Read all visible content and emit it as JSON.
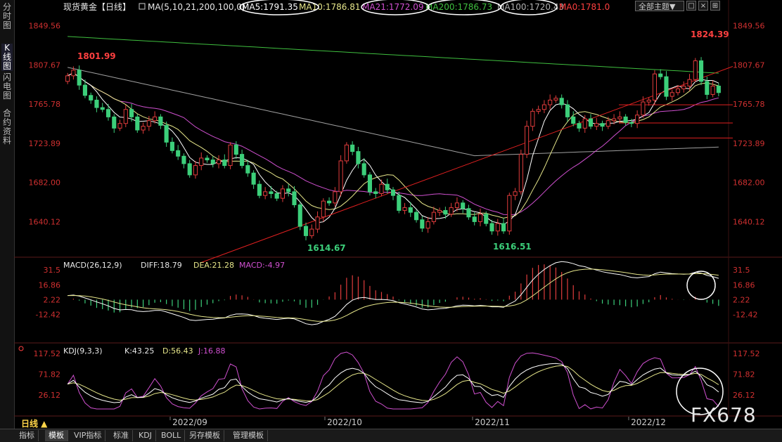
{
  "left_tabs": [
    {
      "label": "分时图",
      "active": false
    },
    {
      "label": "K线图",
      "active": true
    },
    {
      "label": "闪电图",
      "active": false
    },
    {
      "label": "合约资料",
      "active": false
    }
  ],
  "toolbar": {
    "theme_label": "全部主题▼",
    "btn1": "□",
    "btn2": "×",
    "btn3": "⊞"
  },
  "period_label": "日线 ▲",
  "bottom_tabs": [
    "指标",
    "模板",
    "VIP指标",
    "标准",
    "KDJ",
    "BOLL",
    "另存模板",
    "管理模板"
  ],
  "bottom_active": 1,
  "watermark": "FX678",
  "header": {
    "title": "现货黄金【日线】",
    "ma_params": "MA(5,10,21,200,100,0)",
    "ma5": "MA5:1791.35",
    "ma10": "MA10:1786.81",
    "ma21": "MA21:1772.09",
    "ma200": "MA200:1786.73",
    "ma100": "MA100:1720.43",
    "ma0": "MA0:1781.0"
  },
  "colors": {
    "up": "#e03c3c",
    "down": "#3ccf7a",
    "ma5": "#ffffff",
    "ma10": "#e6e68a",
    "ma21": "#d050d0",
    "ma200": "#3fbf3f",
    "ma100": "#a0a0a0",
    "trend": "#e02020"
  },
  "chart_data": [
    {
      "type": "candlestick",
      "title": "现货黄金【日线】",
      "y_ticks": [
        1849.56,
        1807.67,
        1765.78,
        1723.89,
        1682.0,
        1640.12
      ],
      "ylim": [
        1605,
        1862
      ],
      "x_labels": [
        "2022/09",
        "2022/10",
        "2022/11",
        "2022/12"
      ],
      "annotations": [
        {
          "text": "1801.99",
          "value": 1801.99
        },
        {
          "text": "1614.67",
          "value": 1614.67
        },
        {
          "text": "1616.51",
          "value": 1616.51
        },
        {
          "text": "1824.39",
          "value": 1824.39
        }
      ],
      "closes": [
        1796,
        1802,
        1786,
        1775,
        1770,
        1762,
        1760,
        1752,
        1740,
        1745,
        1760,
        1752,
        1738,
        1742,
        1748,
        1752,
        1743,
        1725,
        1716,
        1710,
        1702,
        1690,
        1700,
        1708,
        1706,
        1702,
        1706,
        1700,
        1722,
        1712,
        1700,
        1692,
        1680,
        1668,
        1672,
        1670,
        1665,
        1675,
        1672,
        1658,
        1635,
        1625,
        1632,
        1645,
        1662,
        1660,
        1672,
        1705,
        1722,
        1715,
        1702,
        1690,
        1672,
        1670,
        1680,
        1674,
        1668,
        1652,
        1655,
        1650,
        1642,
        1633,
        1640,
        1650,
        1652,
        1648,
        1655,
        1660,
        1654,
        1645,
        1640,
        1648,
        1638,
        1630,
        1638,
        1630,
        1668,
        1672,
        1712,
        1742,
        1758,
        1760,
        1765,
        1770,
        1772,
        1765,
        1752,
        1745,
        1740,
        1750,
        1742,
        1745,
        1742,
        1748,
        1750,
        1752,
        1746,
        1745,
        1754,
        1768,
        1770,
        1798,
        1795,
        1774,
        1778,
        1782,
        1785,
        1792,
        1812,
        1790,
        1776,
        1785,
        1778
      ],
      "opens": [
        1790,
        1796,
        1802,
        1786,
        1775,
        1770,
        1762,
        1760,
        1752,
        1740,
        1745,
        1760,
        1752,
        1738,
        1742,
        1748,
        1752,
        1743,
        1725,
        1716,
        1710,
        1702,
        1690,
        1700,
        1708,
        1706,
        1702,
        1706,
        1700,
        1722,
        1712,
        1700,
        1692,
        1680,
        1668,
        1672,
        1670,
        1665,
        1675,
        1672,
        1658,
        1635,
        1625,
        1632,
        1645,
        1662,
        1660,
        1672,
        1705,
        1722,
        1715,
        1702,
        1690,
        1672,
        1670,
        1680,
        1674,
        1668,
        1652,
        1655,
        1650,
        1642,
        1633,
        1640,
        1650,
        1652,
        1648,
        1655,
        1660,
        1654,
        1645,
        1640,
        1648,
        1638,
        1630,
        1638,
        1630,
        1668,
        1672,
        1712,
        1742,
        1758,
        1760,
        1765,
        1770,
        1772,
        1765,
        1752,
        1745,
        1740,
        1750,
        1742,
        1745,
        1742,
        1748,
        1750,
        1752,
        1746,
        1745,
        1754,
        1768,
        1770,
        1798,
        1795,
        1774,
        1778,
        1782,
        1785,
        1792,
        1812,
        1790,
        1776,
        1785
      ],
      "trendline": [
        [
          1596.0,
          1806.0
        ]
      ],
      "hlines": [
        1765.0,
        1745.5,
        1729.5
      ]
    },
    {
      "type": "macd",
      "title": "MACD(26,12,9)",
      "diff_label": "DIFF:18.79",
      "dea_label": "DEA:21.28",
      "macd_label": "MACD:-4.97",
      "y_ticks": [
        31.5,
        16.86,
        2.22,
        -12.42
      ],
      "ylim": [
        -35,
        40
      ]
    },
    {
      "type": "kdj",
      "title": "KDJ(9,3,3)",
      "k_label": "K:43.25",
      "d_label": "D:56.43",
      "j_label": "J:16.88",
      "y_ticks": [
        117.52,
        71.82,
        26.12
      ],
      "ylim": [
        -5,
        130
      ]
    }
  ]
}
